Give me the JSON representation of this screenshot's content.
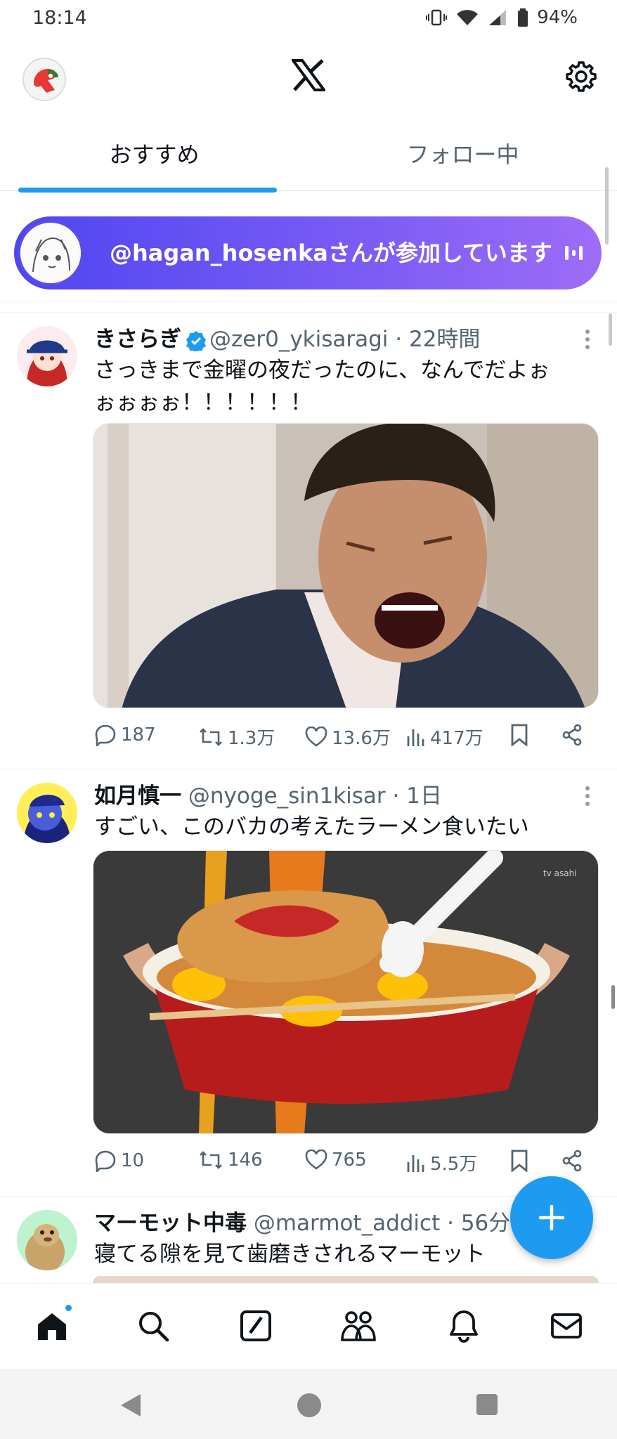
{
  "status_bar": {
    "time": "18:14",
    "battery": "94%"
  },
  "header": {
    "logo": "x-logo-icon",
    "settings_icon": "gear-icon"
  },
  "tabs": [
    {
      "label": "おすすめ",
      "active": true
    },
    {
      "label": "フォロー中",
      "active": false
    }
  ],
  "spaces": {
    "text": "@hagan_hosenkaさんが参加しています"
  },
  "tweets": [
    {
      "name": "きさらぎ",
      "verified": true,
      "handle": "@zer0_ykisaragi",
      "time": "· 22時間",
      "text_line1": "さっきまで金曜の夜だったのに、なんでだよぉ",
      "text_line2": "ぉぉぉぉ！！！！！！",
      "replies": "187",
      "retweets": "1.3万",
      "likes": "13.6万",
      "views": "417万"
    },
    {
      "name": "如月慎一",
      "verified": false,
      "handle": "@nyoge_sin1kisar",
      "time": "· 1日",
      "text_line1": "すごい、このバカの考えたラーメン食いたい",
      "media_watermark": "tv asahi",
      "replies": "10",
      "retweets": "146",
      "likes": "765",
      "views": "5.5万"
    },
    {
      "name": "マーモット中毒",
      "verified": false,
      "handle": "@marmot_addict",
      "time": "· 56分",
      "text_line1": "寝てる隙を見て歯磨きされるマーモット"
    }
  ],
  "bottom_nav": [
    "home-icon",
    "search-icon",
    "grok-icon",
    "communities-icon",
    "notifications-icon",
    "messages-icon"
  ],
  "colors": {
    "accent": "#1d9bf0",
    "spaces_start": "#4f46f0",
    "spaces_end": "#9f6cf7"
  }
}
